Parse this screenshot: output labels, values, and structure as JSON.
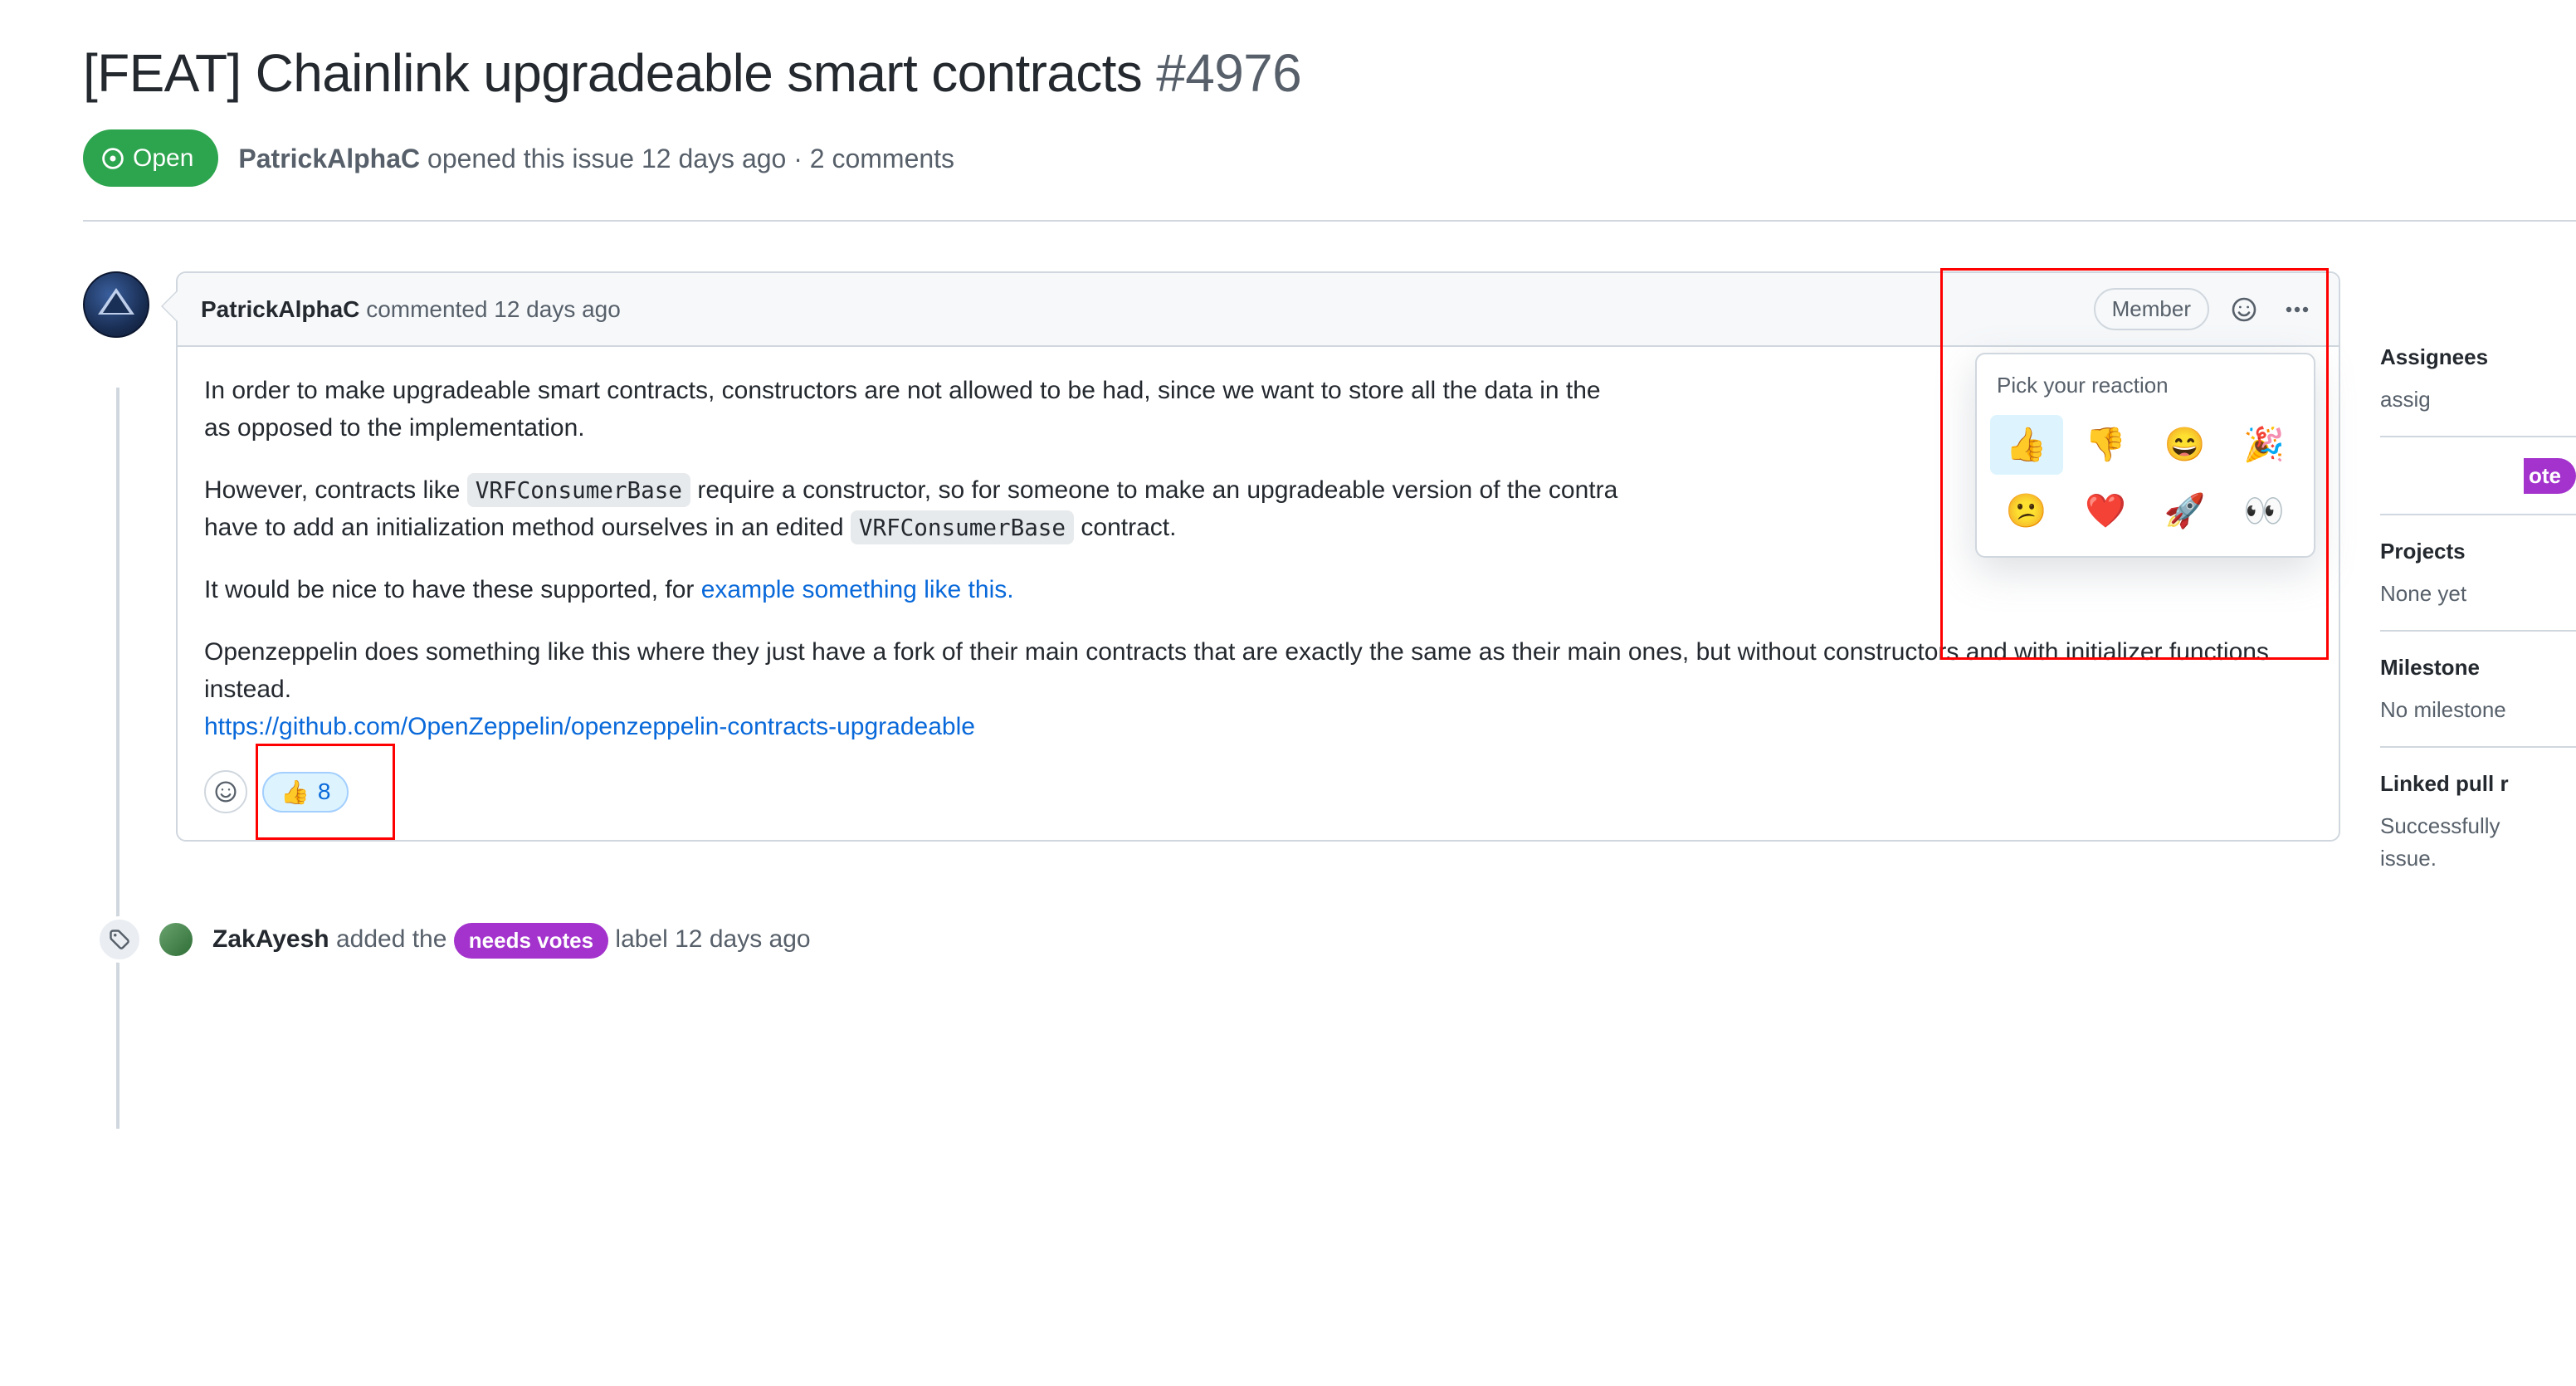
{
  "issue": {
    "title": "[FEAT] Chainlink upgradeable smart contracts",
    "number": "#4976",
    "state": "Open",
    "opened_by": "PatrickAlphaC",
    "opened_text": "opened this issue 12 days ago · 2 comments"
  },
  "comment": {
    "author": "PatrickAlphaC",
    "when": "commented 12 days ago",
    "role": "Member",
    "p1a": "In order to make upgradeable smart contracts, constructors are not allowed to be had, since we want to store all the data in the ",
    "p1b": "as opposed to the implementation.",
    "p2a": "However, contracts like ",
    "code1": "VRFConsumerBase",
    "p2b": " require a constructor, so for someone to make an upgradeable version of the contra",
    "p2c": "have to add an initialization method ourselves in an edited ",
    "code2": "VRFConsumerBase",
    "p2d": " contract.",
    "p3a": "It would be nice to have these supported, for ",
    "link1": "example something like this.",
    "p4": "Openzeppelin does something like this where they just have a fork of their main contracts that are exactly the same as their main ones, but without constructors and with initializer functions instead.",
    "link2": "https://github.com/OpenZeppelin/openzeppelin-contracts-upgradeable",
    "reaction_emoji": "👍",
    "reaction_count": "8"
  },
  "popover": {
    "title": "Pick your reaction",
    "emojis": [
      "👍",
      "👎",
      "😄",
      "🎉",
      "😕",
      "❤️",
      "🚀",
      "👀"
    ]
  },
  "event": {
    "user": "ZakAyesh",
    "pre": " added the ",
    "label": "needs votes",
    "post": " label 12 days ago"
  },
  "sidebar": {
    "assignees_h": "Assignees",
    "assignees_b": "assig",
    "labels_frag": "ote",
    "projects_h": "Projects",
    "projects_b": "None yet",
    "milestone_h": "Milestone",
    "milestone_b": "No milestone",
    "linked_h": "Linked pull r",
    "linked_b1": "Successfully ",
    "linked_b2": "issue."
  }
}
